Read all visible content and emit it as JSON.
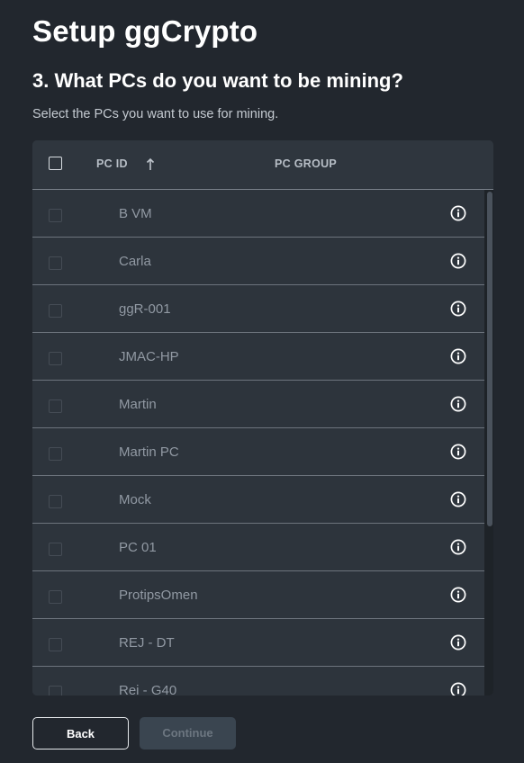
{
  "header": {
    "title": "Setup ggCrypto",
    "step_title": "3. What PCs do you want to be mining?",
    "subtitle": "Select the PCs you want to use for mining."
  },
  "table": {
    "columns": {
      "pc_id": "PC ID",
      "pc_group": "PC GROUP"
    },
    "sort": {
      "column": "pc_id",
      "direction": "ascending",
      "icon": "arrow-up-icon"
    },
    "rows": [
      {
        "pc_id": "B VM",
        "pc_group": "",
        "selected": false,
        "icon": "info-icon"
      },
      {
        "pc_id": "Carla",
        "pc_group": "",
        "selected": false,
        "icon": "info-icon"
      },
      {
        "pc_id": "ggR-001",
        "pc_group": "",
        "selected": false,
        "icon": "info-icon"
      },
      {
        "pc_id": "JMAC-HP",
        "pc_group": "",
        "selected": false,
        "icon": "info-icon"
      },
      {
        "pc_id": "Martin",
        "pc_group": "",
        "selected": false,
        "icon": "info-icon"
      },
      {
        "pc_id": "Martin PC",
        "pc_group": "",
        "selected": false,
        "icon": "info-icon"
      },
      {
        "pc_id": "Mock",
        "pc_group": "",
        "selected": false,
        "icon": "info-icon"
      },
      {
        "pc_id": "PC 01",
        "pc_group": "",
        "selected": false,
        "icon": "info-icon"
      },
      {
        "pc_id": "ProtipsOmen",
        "pc_group": "",
        "selected": false,
        "icon": "info-icon"
      },
      {
        "pc_id": "REJ - DT",
        "pc_group": "",
        "selected": false,
        "icon": "info-icon"
      },
      {
        "pc_id": "Rei - G40",
        "pc_group": "",
        "selected": false,
        "icon": "info-icon"
      }
    ]
  },
  "footer": {
    "back_label": "Back",
    "continue_label": "Continue",
    "continue_enabled": false
  },
  "colors": {
    "background": "#22272e",
    "table_background": "#2d343c",
    "row_text": "#9199a3",
    "continue_disabled_bg": "#3a4550"
  }
}
